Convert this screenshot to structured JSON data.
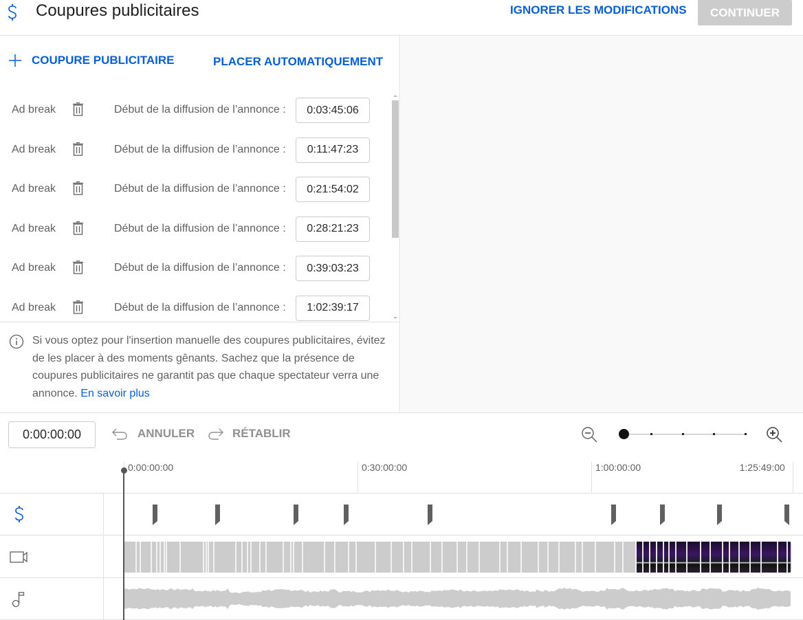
{
  "header": {
    "title": "Coupures publicitaires",
    "title_icon": "dollar-icon",
    "discard_label": "IGNORER LES MODIFICATIONS",
    "continue_label": "CONTINUER"
  },
  "actions": {
    "add_label": "COUPURE PUBLICITAIRE",
    "auto_label": "PLACER AUTOMATIQUEMENT"
  },
  "ad_breaks": [
    {
      "label": "Ad break",
      "start_label": "Début de la diffusion de l’annonce :",
      "time": "0:03:45:06"
    },
    {
      "label": "Ad break",
      "start_label": "Début de la diffusion de l’annonce :",
      "time": "0:11:47:23"
    },
    {
      "label": "Ad break",
      "start_label": "Début de la diffusion de l’annonce :",
      "time": "0:21:54:02"
    },
    {
      "label": "Ad break",
      "start_label": "Début de la diffusion de l’annonce :",
      "time": "0:28:21:23"
    },
    {
      "label": "Ad break",
      "start_label": "Début de la diffusion de l’annonce :",
      "time": "0:39:03:23"
    },
    {
      "label": "Ad break",
      "start_label": "Début de la diffusion de l’annonce :",
      "time": "1:02:39:17"
    }
  ],
  "info": {
    "text": "Si vous optez pour l'insertion manuelle des coupures publicitaires, évitez de les placer à des moments gênants. Sachez que la présence de coupures publicitaires ne garantit pas que chaque spectateur verra une annonce. ",
    "link": "En savoir plus"
  },
  "toolbar": {
    "current_time": "0:00:00:00",
    "undo_label": "ANNULER",
    "redo_label": "RÉTABLIR",
    "zoom_level_index": 0,
    "zoom_steps": 5
  },
  "timeline": {
    "duration_minutes": 85.82,
    "playhead_minutes": 0,
    "ticks": [
      {
        "label": "0:00:00:00",
        "minutes": 0
      },
      {
        "label": "0:30:00:00",
        "minutes": 30
      },
      {
        "label": "1:00:00:00",
        "minutes": 60
      },
      {
        "label": "1:25:49:00",
        "minutes": 85.82
      }
    ],
    "ad_marker_minutes": [
      3.75,
      11.79,
      21.9,
      28.36,
      39.06,
      62.66,
      68.9,
      76.2,
      84.9
    ],
    "track_icons": [
      "dollar-icon",
      "video-camera-icon",
      "music-note-icon"
    ]
  },
  "colors": {
    "accent": "#065fd4",
    "disabled_button": "#cccccc",
    "marker": "#606060"
  }
}
